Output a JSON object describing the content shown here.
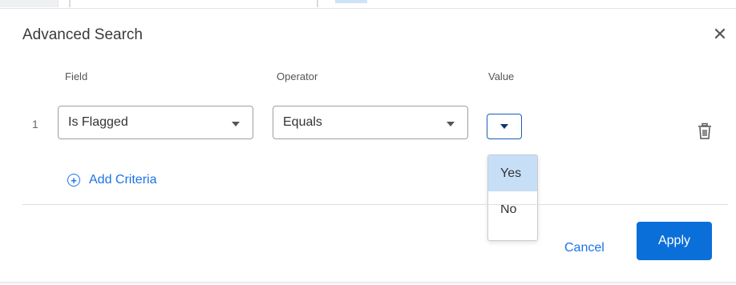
{
  "dialog": {
    "title": "Advanced Search",
    "close_icon": "close-icon",
    "close_glyph": "✕"
  },
  "columns": {
    "field": "Field",
    "operator": "Operator",
    "value": "Value"
  },
  "criteria": [
    {
      "index": "1",
      "field": "Is Flagged",
      "operator": "Equals",
      "value": "",
      "delete_icon": "trash-icon"
    }
  ],
  "value_dropdown": {
    "open": true,
    "options": [
      "Yes",
      "No"
    ],
    "highlighted": "Yes"
  },
  "add_criteria": {
    "label": "Add Criteria",
    "icon": "plus-circle-icon",
    "glyph": "+"
  },
  "footer": {
    "cancel_label": "Cancel",
    "apply_label": "Apply"
  },
  "colors": {
    "accent": "#1a73e8",
    "apply_button": "#0b6fd9",
    "option_highlight": "#c7def7",
    "value_select_border": "#1a5fb4"
  }
}
